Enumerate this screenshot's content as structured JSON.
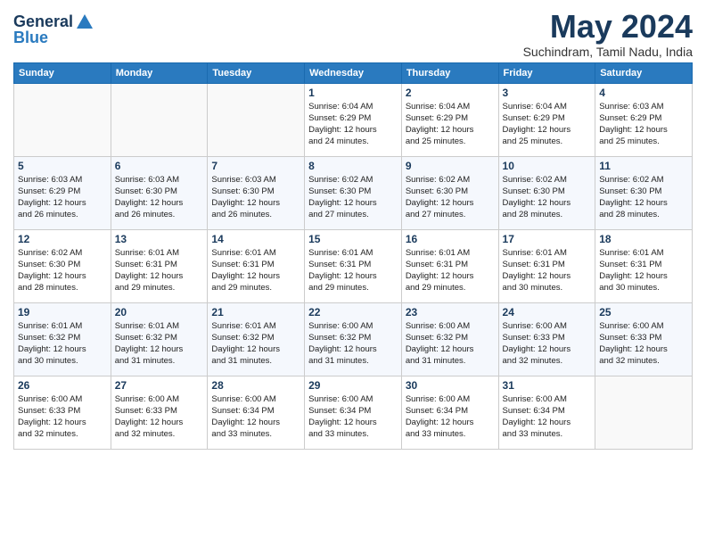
{
  "logo": {
    "general": "General",
    "blue": "Blue"
  },
  "title": "May 2024",
  "location": "Suchindram, Tamil Nadu, India",
  "headers": [
    "Sunday",
    "Monday",
    "Tuesday",
    "Wednesday",
    "Thursday",
    "Friday",
    "Saturday"
  ],
  "weeks": [
    [
      {
        "day": "",
        "info": ""
      },
      {
        "day": "",
        "info": ""
      },
      {
        "day": "",
        "info": ""
      },
      {
        "day": "1",
        "info": "Sunrise: 6:04 AM\nSunset: 6:29 PM\nDaylight: 12 hours\nand 24 minutes."
      },
      {
        "day": "2",
        "info": "Sunrise: 6:04 AM\nSunset: 6:29 PM\nDaylight: 12 hours\nand 25 minutes."
      },
      {
        "day": "3",
        "info": "Sunrise: 6:04 AM\nSunset: 6:29 PM\nDaylight: 12 hours\nand 25 minutes."
      },
      {
        "day": "4",
        "info": "Sunrise: 6:03 AM\nSunset: 6:29 PM\nDaylight: 12 hours\nand 25 minutes."
      }
    ],
    [
      {
        "day": "5",
        "info": "Sunrise: 6:03 AM\nSunset: 6:29 PM\nDaylight: 12 hours\nand 26 minutes."
      },
      {
        "day": "6",
        "info": "Sunrise: 6:03 AM\nSunset: 6:30 PM\nDaylight: 12 hours\nand 26 minutes."
      },
      {
        "day": "7",
        "info": "Sunrise: 6:03 AM\nSunset: 6:30 PM\nDaylight: 12 hours\nand 26 minutes."
      },
      {
        "day": "8",
        "info": "Sunrise: 6:02 AM\nSunset: 6:30 PM\nDaylight: 12 hours\nand 27 minutes."
      },
      {
        "day": "9",
        "info": "Sunrise: 6:02 AM\nSunset: 6:30 PM\nDaylight: 12 hours\nand 27 minutes."
      },
      {
        "day": "10",
        "info": "Sunrise: 6:02 AM\nSunset: 6:30 PM\nDaylight: 12 hours\nand 28 minutes."
      },
      {
        "day": "11",
        "info": "Sunrise: 6:02 AM\nSunset: 6:30 PM\nDaylight: 12 hours\nand 28 minutes."
      }
    ],
    [
      {
        "day": "12",
        "info": "Sunrise: 6:02 AM\nSunset: 6:30 PM\nDaylight: 12 hours\nand 28 minutes."
      },
      {
        "day": "13",
        "info": "Sunrise: 6:01 AM\nSunset: 6:31 PM\nDaylight: 12 hours\nand 29 minutes."
      },
      {
        "day": "14",
        "info": "Sunrise: 6:01 AM\nSunset: 6:31 PM\nDaylight: 12 hours\nand 29 minutes."
      },
      {
        "day": "15",
        "info": "Sunrise: 6:01 AM\nSunset: 6:31 PM\nDaylight: 12 hours\nand 29 minutes."
      },
      {
        "day": "16",
        "info": "Sunrise: 6:01 AM\nSunset: 6:31 PM\nDaylight: 12 hours\nand 29 minutes."
      },
      {
        "day": "17",
        "info": "Sunrise: 6:01 AM\nSunset: 6:31 PM\nDaylight: 12 hours\nand 30 minutes."
      },
      {
        "day": "18",
        "info": "Sunrise: 6:01 AM\nSunset: 6:31 PM\nDaylight: 12 hours\nand 30 minutes."
      }
    ],
    [
      {
        "day": "19",
        "info": "Sunrise: 6:01 AM\nSunset: 6:32 PM\nDaylight: 12 hours\nand 30 minutes."
      },
      {
        "day": "20",
        "info": "Sunrise: 6:01 AM\nSunset: 6:32 PM\nDaylight: 12 hours\nand 31 minutes."
      },
      {
        "day": "21",
        "info": "Sunrise: 6:01 AM\nSunset: 6:32 PM\nDaylight: 12 hours\nand 31 minutes."
      },
      {
        "day": "22",
        "info": "Sunrise: 6:00 AM\nSunset: 6:32 PM\nDaylight: 12 hours\nand 31 minutes."
      },
      {
        "day": "23",
        "info": "Sunrise: 6:00 AM\nSunset: 6:32 PM\nDaylight: 12 hours\nand 31 minutes."
      },
      {
        "day": "24",
        "info": "Sunrise: 6:00 AM\nSunset: 6:33 PM\nDaylight: 12 hours\nand 32 minutes."
      },
      {
        "day": "25",
        "info": "Sunrise: 6:00 AM\nSunset: 6:33 PM\nDaylight: 12 hours\nand 32 minutes."
      }
    ],
    [
      {
        "day": "26",
        "info": "Sunrise: 6:00 AM\nSunset: 6:33 PM\nDaylight: 12 hours\nand 32 minutes."
      },
      {
        "day": "27",
        "info": "Sunrise: 6:00 AM\nSunset: 6:33 PM\nDaylight: 12 hours\nand 32 minutes."
      },
      {
        "day": "28",
        "info": "Sunrise: 6:00 AM\nSunset: 6:34 PM\nDaylight: 12 hours\nand 33 minutes."
      },
      {
        "day": "29",
        "info": "Sunrise: 6:00 AM\nSunset: 6:34 PM\nDaylight: 12 hours\nand 33 minutes."
      },
      {
        "day": "30",
        "info": "Sunrise: 6:00 AM\nSunset: 6:34 PM\nDaylight: 12 hours\nand 33 minutes."
      },
      {
        "day": "31",
        "info": "Sunrise: 6:00 AM\nSunset: 6:34 PM\nDaylight: 12 hours\nand 33 minutes."
      },
      {
        "day": "",
        "info": ""
      }
    ]
  ]
}
